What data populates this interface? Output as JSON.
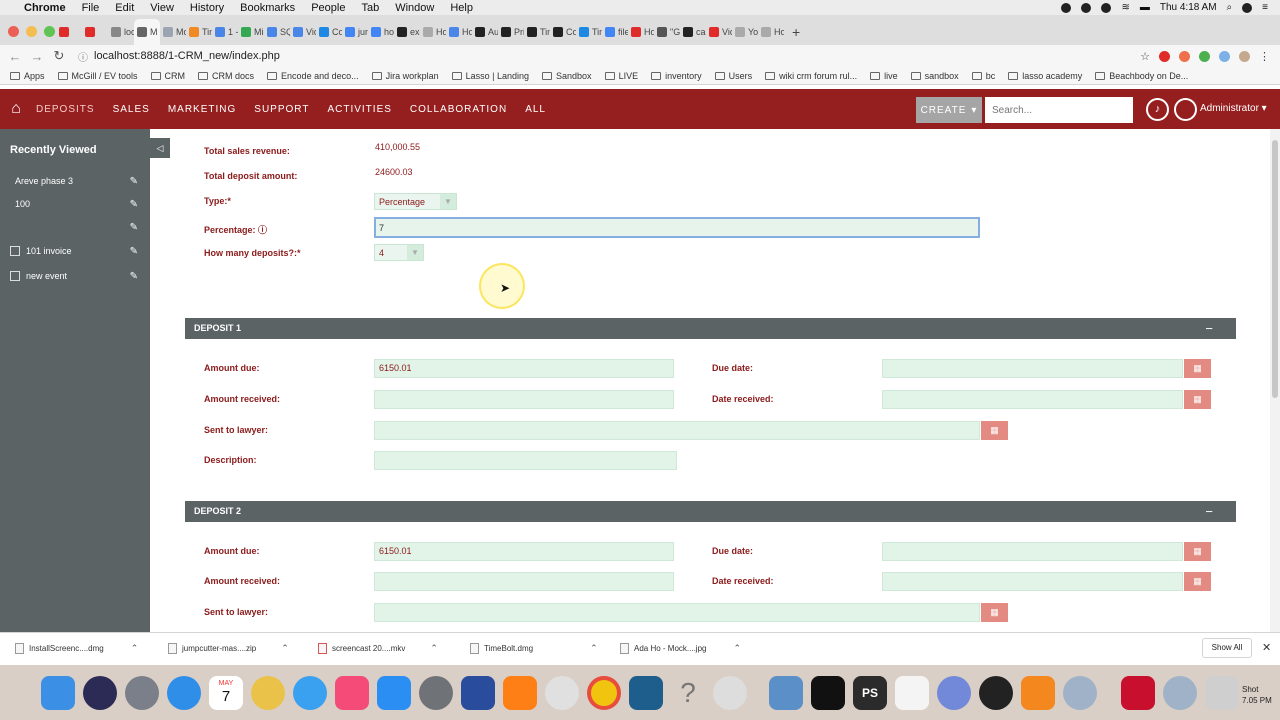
{
  "mac_menu": {
    "items": [
      "Chrome",
      "File",
      "Edit",
      "View",
      "History",
      "Bookmarks",
      "People",
      "Tab",
      "Window",
      "Help"
    ],
    "clock": "Thu 4:18 AM"
  },
  "browser": {
    "tabs": [
      {
        "label": "",
        "color": "#e02b2b"
      },
      {
        "label": "",
        "color": "#e02b2b"
      },
      {
        "label": "loca",
        "color": "#888888"
      },
      {
        "label": "M",
        "color": "#666666",
        "active": true
      },
      {
        "label": "McG",
        "color": "#9aa5b1"
      },
      {
        "label": "Tim",
        "color": "#f08a24"
      },
      {
        "label": "1 - D",
        "color": "#4a86e8"
      },
      {
        "label": "Mis",
        "color": "#34a853"
      },
      {
        "label": "SQL",
        "color": "#4a86e8"
      },
      {
        "label": "Vide",
        "color": "#4a86e8"
      },
      {
        "label": "Con",
        "color": "#1e88e5"
      },
      {
        "label": "jum",
        "color": "#4285f4"
      },
      {
        "label": "how",
        "color": "#4285f4"
      },
      {
        "label": "exci",
        "color": "#222222"
      },
      {
        "label": "How",
        "color": "#aaaaaa"
      },
      {
        "label": "How",
        "color": "#4a86e8"
      },
      {
        "label": "Auto",
        "color": "#222222"
      },
      {
        "label": "Pric",
        "color": "#222222"
      },
      {
        "label": "Tim",
        "color": "#222222"
      },
      {
        "label": "Con",
        "color": "#222222"
      },
      {
        "label": "Tim",
        "color": "#1e88e5"
      },
      {
        "label": "file",
        "color": "#4285f4"
      },
      {
        "label": "How",
        "color": "#e02b2b"
      },
      {
        "label": "\"Go",
        "color": "#555555"
      },
      {
        "label": "cary",
        "color": "#222222"
      },
      {
        "label": "Vide",
        "color": "#e02b2b"
      },
      {
        "label": "You",
        "color": "#aaaaaa"
      },
      {
        "label": "How",
        "color": "#aaaaaa"
      }
    ],
    "url": "localhost:8888/1-CRM_new/index.php",
    "bookmarks": [
      "Apps",
      "McGill / EV tools",
      "CRM",
      "CRM docs",
      "Encode and deco...",
      "Jira workplan",
      "Lasso | Landing",
      "Sandbox",
      "LIVE",
      "inventory",
      "Users",
      "wiki crm forum rul...",
      "live",
      "sandbox",
      "bc",
      "lasso academy",
      "Beachbody on De..."
    ]
  },
  "crm_nav": {
    "items": [
      "DEPOSITS",
      "SALES",
      "MARKETING",
      "SUPPORT",
      "ACTIVITIES",
      "COLLABORATION",
      "ALL"
    ],
    "create_label": "CREATE",
    "search_placeholder": "Search...",
    "user": "Administrator"
  },
  "sidebar": {
    "title": "Recently Viewed",
    "items": [
      {
        "label": "Areve phase 3",
        "icon": ""
      },
      {
        "label": "100",
        "icon": ""
      },
      {
        "label": "",
        "icon": ""
      },
      {
        "label": "101 invoice",
        "icon": "document-icon"
      },
      {
        "label": "new event",
        "icon": "calendar-icon"
      }
    ]
  },
  "summary": {
    "total_sales_label": "Total sales revenue:",
    "total_sales_value": "410,000.55",
    "total_deposit_label": "Total deposit amount:",
    "total_deposit_value": "24600.03",
    "type_label": "Type:*",
    "type_value": "Percentage",
    "percentage_label": "Percentage:",
    "percentage_value": "7",
    "how_many_label": "How many deposits?:*",
    "how_many_value": "4"
  },
  "deposits": [
    {
      "title": "DEPOSIT 1",
      "amount_due_label": "Amount due:",
      "amount_due_value": "6150.01",
      "due_date_label": "Due date:",
      "amount_received_label": "Amount received:",
      "date_received_label": "Date received:",
      "sent_to_lawyer_label": "Sent to lawyer:",
      "description_label": "Description:"
    },
    {
      "title": "DEPOSIT 2",
      "amount_due_label": "Amount due:",
      "amount_due_value": "6150.01",
      "due_date_label": "Due date:",
      "amount_received_label": "Amount received:",
      "date_received_label": "Date received:",
      "sent_to_lawyer_label": "Sent to lawyer:"
    }
  ],
  "downloads": {
    "items": [
      "InstallScreenc....dmg",
      "jumpcutter-mas....zip",
      "screencast 20....mkv",
      "TimeBolt.dmg",
      "Ada Ho - Mock....jpg"
    ],
    "show_all": "Show All"
  },
  "dock": {
    "calendar_month": "MAY",
    "calendar_day": "7",
    "time_label_1": "Shot",
    "time_label_2": "7.05 PM"
  },
  "colors": {
    "nav_bg": "#951f1f",
    "sidebar_bg": "#5b6364",
    "label_red": "#8b1a1a",
    "field_green": "#e2f3e8",
    "calendar_btn": "#e38b82"
  }
}
